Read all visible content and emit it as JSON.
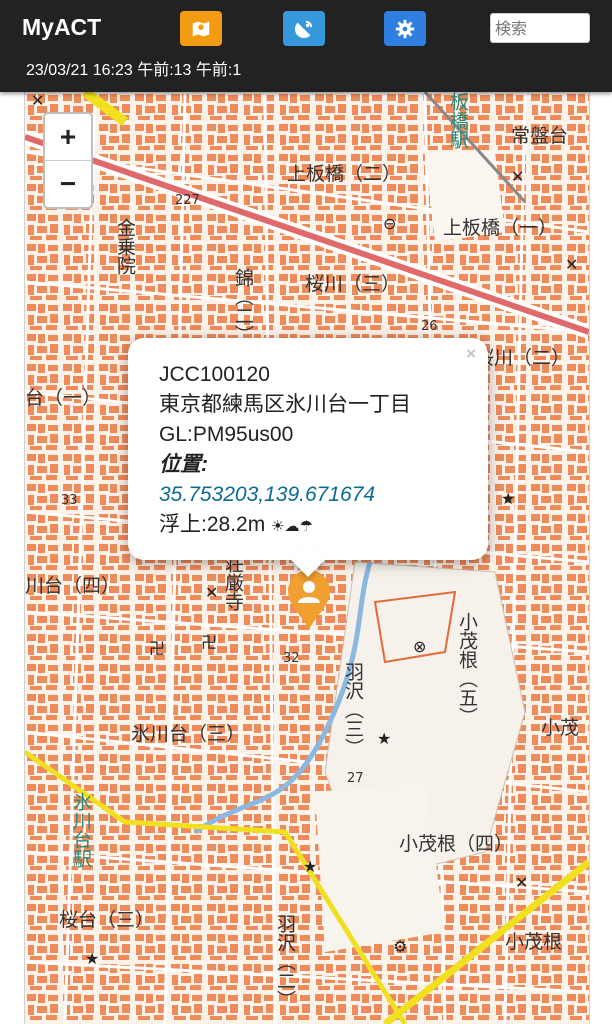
{
  "app": {
    "title": "MyACT",
    "status_line": "23/03/21 16:23 午前:13 午前:1"
  },
  "toolbar": {
    "buttons": [
      {
        "name": "map-button",
        "icon": "map-icon",
        "color": "#f39c12"
      },
      {
        "name": "antenna-button",
        "icon": "satellite-dish-icon",
        "color": "#3498db"
      },
      {
        "name": "settings-button",
        "icon": "gear-icon",
        "color": "#2f7fe0"
      }
    ],
    "search_placeholder": "検索"
  },
  "map": {
    "zoom_in_label": "+",
    "zoom_out_label": "−",
    "labels": {
      "kamiitabashi_2": "上板橋（二）",
      "kamiitabashi_1": "上板橋（一）",
      "sakuragawa_3": "桜川（三）",
      "sakuragawa_2": "桜川（二）",
      "hikawadai_4": "川台（四）",
      "hikawadai_3": "氷川台（三）",
      "komone_4": "小茂根（四）",
      "komone": "小茂根",
      "komone_5": "小茂根（五）",
      "komo": "小茂",
      "sakuradai_3": "桜台（三）",
      "hazawa_3": "羽沢（三）",
      "hazawa_2": "羽沢（二）",
      "tokiwadai": "常盤台",
      "itabashi_sta": "板橋駅",
      "hikawadai_sta": "氷川台駅",
      "kanejoin": "金乗院",
      "gongenji": "荘厳寺",
      "nishiki": "錦（二）",
      "dai_1": "台（一）",
      "hwy": "227",
      "elev1": "26",
      "elev2": "33",
      "elev3": "27",
      "elev4": "32"
    },
    "popup": {
      "callsign": "JCC100120",
      "address": "東京都練馬区氷川台一丁目",
      "grid_locator": "GL:PM95us00",
      "position_label": "位置:",
      "coordinates": "35.753203,139.671674",
      "elevation": "浮上:28.2m",
      "weather_icons": "☀☁☂",
      "close_label": "×"
    },
    "marker_icon": "user-location-icon",
    "colors": {
      "buildings": "#ef8a5a",
      "roads": "#ffffff",
      "major_road": "#e06a6a",
      "rail": "#f0e020",
      "river": "#8bb8e0",
      "marker": "#f0a030"
    }
  }
}
